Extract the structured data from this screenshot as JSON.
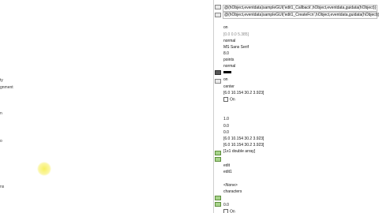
{
  "left_labels": [
    "ty",
    "gnment",
    "n",
    "o",
    "ns"
  ],
  "values": {
    "callback": "@(hObject,eventdata)sampleGUI('edit1_Callback',hObject,eventdata,guidata(hObject))",
    "createfcn": "@(hObject,eventdata)sampleGUI('edit1_CreateFcn',hObject,eventdata,guidata(hObject))",
    "enable": "on",
    "extent": "[0.0 0.0 5.385]",
    "fontangle": "normal",
    "fontname": "MS Sans Serif",
    "fontsize": "8.0",
    "fontunits": "points",
    "fontweight": "normal",
    "handlevisibility": "on",
    "horizontalalignment": "center",
    "inneroutput": "[6.0 10.154 30.2 3.923]",
    "interruptible_label": "On",
    "max": "1.0",
    "min": "0.0",
    "other": "0.0",
    "outerposition": "[6.0 10.154 30.2 3.923]",
    "position": "[6.0 10.154 30.2 3.923]",
    "sliderstep": "[1x1 double array]",
    "style": "edit",
    "tag": "edit1",
    "tooltip": "<None>",
    "units": "characters",
    "value": "0.0",
    "visible_label": "On"
  }
}
